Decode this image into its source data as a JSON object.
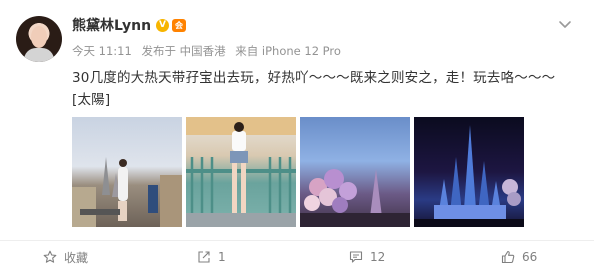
{
  "post": {
    "username": "熊黛林Lynn",
    "time": "今天 11:11",
    "published_from": "发布于 中国香港",
    "device": "来自 iPhone 12 Pro",
    "text": "30几度的大热天带孖宝出去玩，好热吖～～～既来之则安之，走！玩去咯～～～[太陽]"
  },
  "badges": {
    "vip": "V",
    "member": "会"
  },
  "actions": {
    "favorite": "收藏",
    "share": "1",
    "comments": "12",
    "likes": "66"
  },
  "colors": {
    "accent": "#ff8200",
    "vip": "#f7b500",
    "muted": "#939393"
  }
}
